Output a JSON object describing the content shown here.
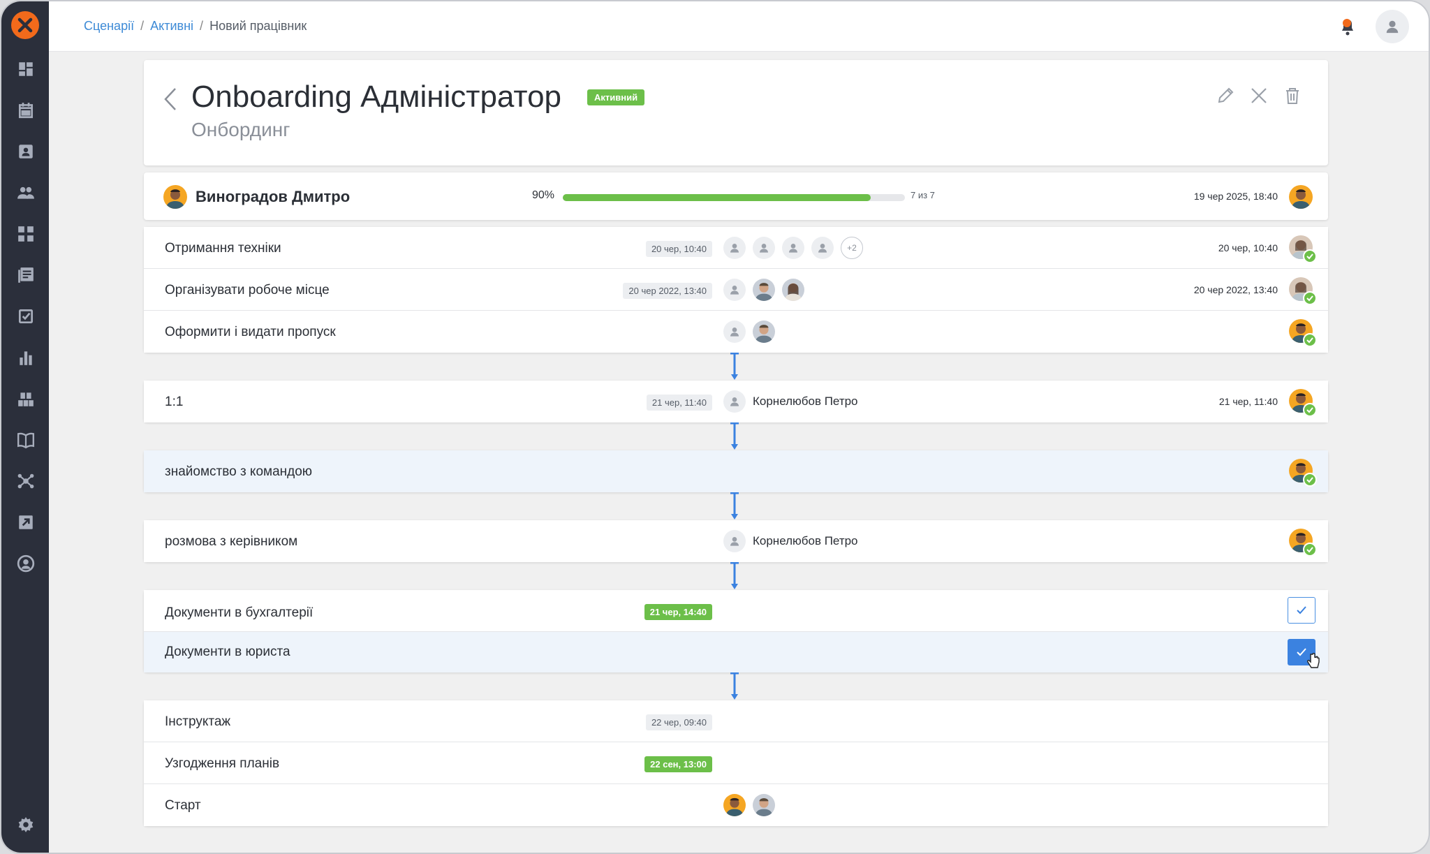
{
  "breadcrumb": {
    "item1": "Сценарії",
    "item2": "Активні",
    "current": "Новий працівник",
    "sep": "/"
  },
  "header": {
    "title": "Onboarding Адміністратор",
    "status": "Активний",
    "subtitle": "Онбординг"
  },
  "employee": {
    "name": "Виноградов Дмитро",
    "progress_label": "90%",
    "progress": 0.9,
    "steps": "7 из 7",
    "date": "19 чер 2025, 18:40"
  },
  "group1": [
    {
      "label": "Отримання техніки",
      "date": "20 чер, 10:40",
      "more": "+2",
      "done_date": "20 чер, 10:40"
    },
    {
      "label": "Організувати робоче місце",
      "date": "20 чер 2022, 13:40",
      "done_date": "20 чер 2022, 13:40"
    },
    {
      "label": "Оформити і видати пропуск"
    }
  ],
  "group2": {
    "label": "1:1",
    "date": "21 чер, 11:40",
    "person": "Корнелюбов Петро",
    "done_date": "21 чер, 11:40"
  },
  "group3": {
    "label": "знайомство з командою"
  },
  "group4": {
    "label": "розмова з керівником",
    "person": "Корнелюбов Петро"
  },
  "group5": [
    {
      "label": "Документи в бухгалтерії",
      "date": "21 чер, 14:40"
    },
    {
      "label": "Документи в юриста"
    }
  ],
  "group6": [
    {
      "label": "Інструктаж",
      "date": "22 чер, 09:40"
    },
    {
      "label": "Узгодження планів",
      "date": "22 сен, 13:00"
    },
    {
      "label": "Старт"
    }
  ],
  "colors": {
    "accent": "#3d8ad6",
    "green": "#6cbf49",
    "sidebar": "#2b2f3b",
    "logo": "#f26a1b"
  }
}
